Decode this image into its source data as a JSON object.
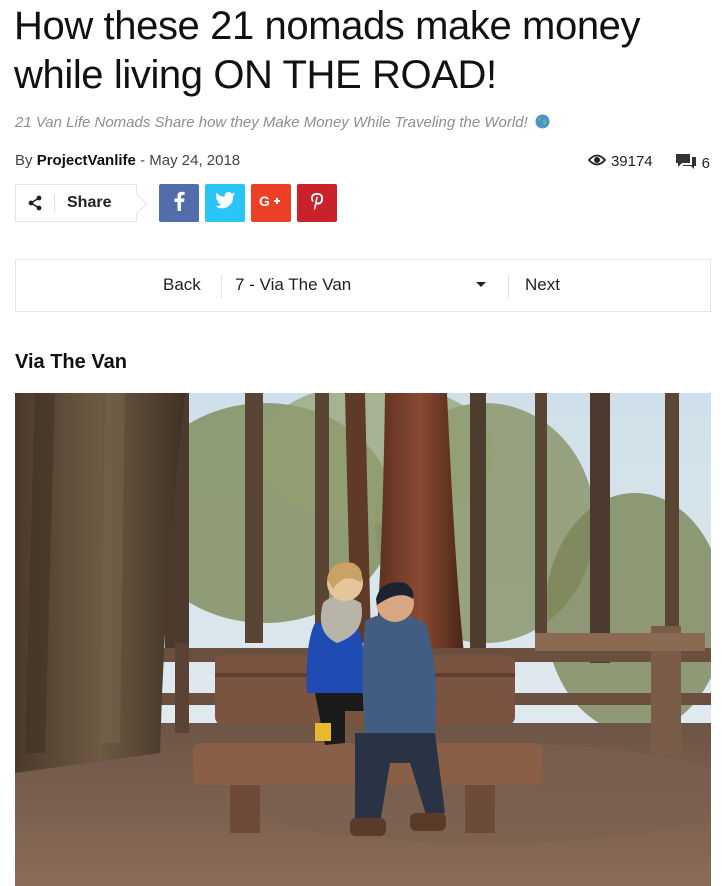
{
  "article": {
    "title": "How these 21 nomads make money while living ON THE ROAD!",
    "subtitle": "21 Van Life Nomads Share how they Make Money While Traveling the World!",
    "by_label": "By",
    "author": "ProjectVanlife",
    "date_separator": "-",
    "date": "May 24, 2018",
    "views": "39174",
    "comments": "6"
  },
  "share": {
    "label": "Share",
    "networks": [
      "facebook-icon",
      "twitter-icon",
      "google-plus-icon",
      "pinterest-icon"
    ],
    "colors": {
      "facebook": "#516eab",
      "twitter": "#29c5f6",
      "google_plus": "#eb4026",
      "pinterest": "#ca212a"
    }
  },
  "pager": {
    "back_label": "Back",
    "selected": "7 - Via The Van",
    "next_label": "Next"
  },
  "section": {
    "heading": "Via The Van"
  },
  "image": {
    "description": "couple-on-bench-in-redwood-forest"
  }
}
